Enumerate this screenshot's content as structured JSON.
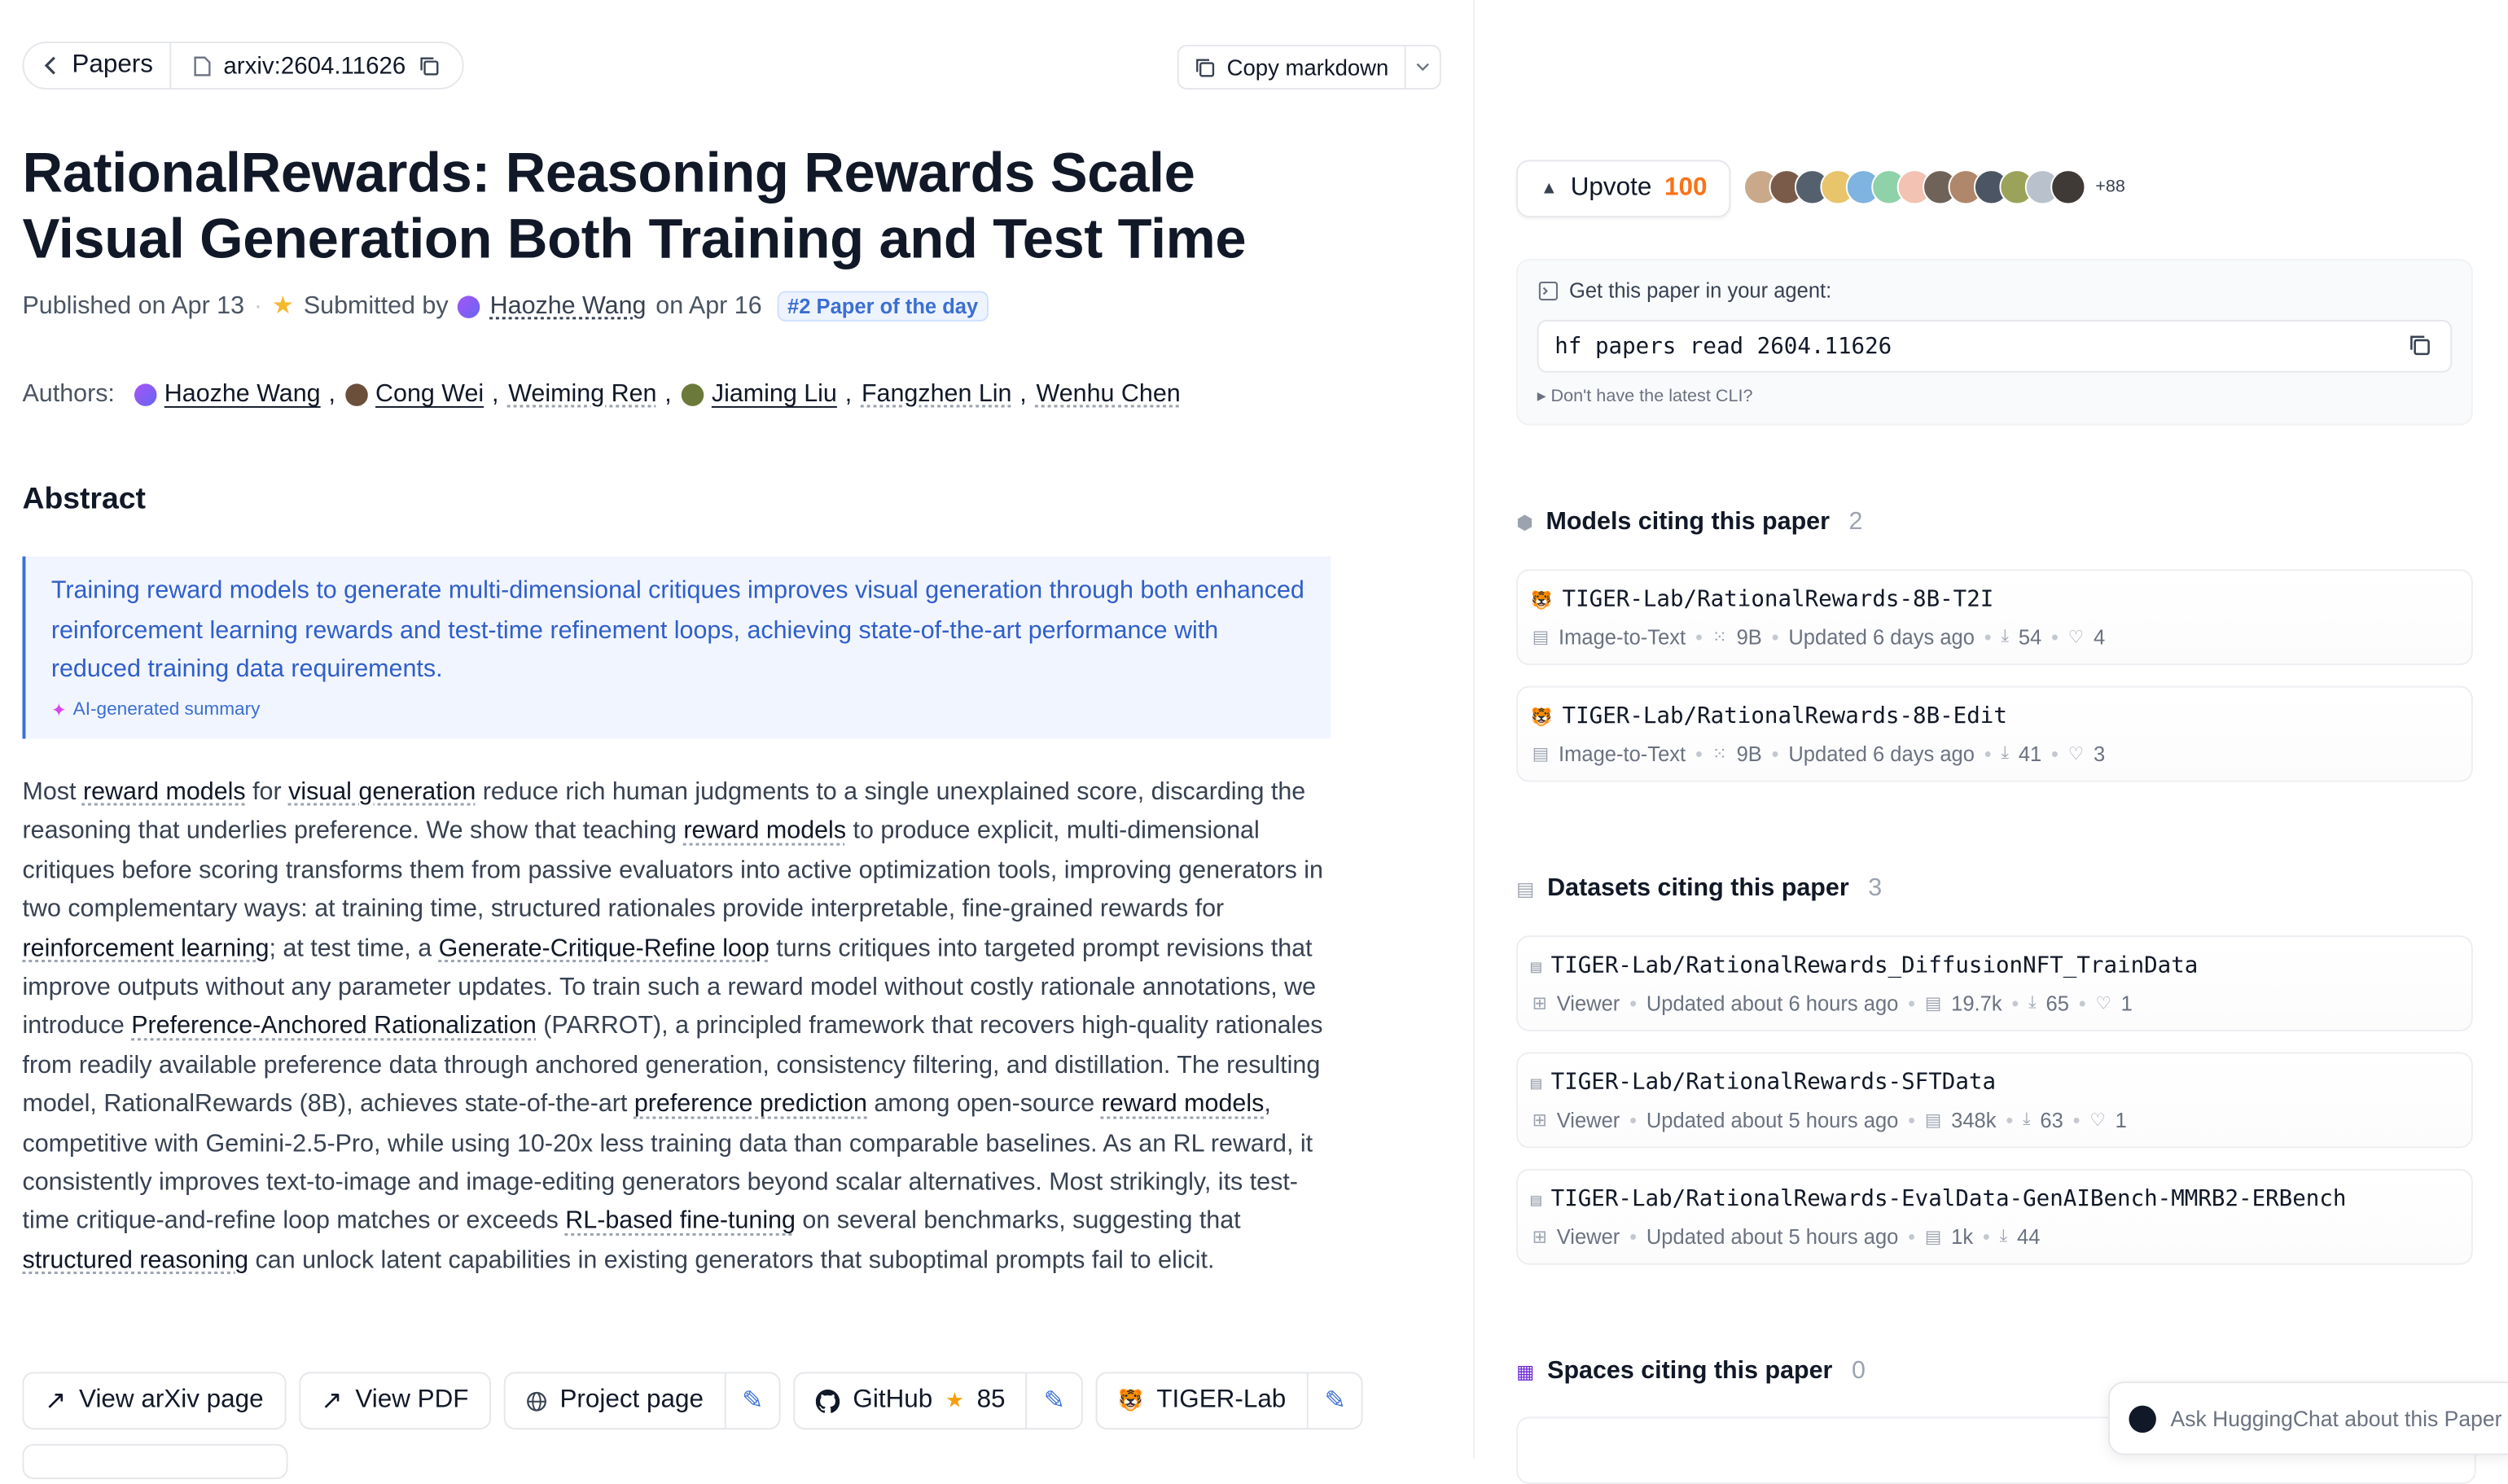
{
  "nav": {
    "back_label": "Papers",
    "paper_id": "arxiv:2604.11626",
    "copy_markdown": "Copy markdown"
  },
  "paper": {
    "title": "RationalRewards: Reasoning Rewards Scale Visual Generation Both Training and Test Time",
    "published": "Published on Apr 13",
    "submitted_by": "Submitted by",
    "submitter": "Haozhe Wang",
    "submitted_on": "on Apr 16",
    "badge": "#2 Paper of the day",
    "authors_label": "Authors:",
    "authors": [
      "Haozhe Wang",
      "Cong Wei",
      "Weiming Ren",
      "Jiaming Liu",
      "Fangzhen Lin",
      "Wenhu Chen"
    ]
  },
  "abstract": {
    "heading": "Abstract",
    "summary": "Training reward models to generate multi-dimensional critiques improves visual generation through both enhanced reinforcement learning rewards and test-time refinement loops, achieving state-of-the-art performance with reduced training data requirements.",
    "ai_label": "AI-generated summary",
    "text": {
      "s1": "Most ",
      "k1": "reward models",
      "s2": " for ",
      "k2": "visual generation",
      "s3": " reduce rich human judgments to a single unexplained score, discarding the reasoning that underlies preference. We show that teaching ",
      "k3": "reward models",
      "s4": " to produce explicit, multi-dimensional critiques before scoring transforms them from passive evaluators into active optimization tools, improving generators in two complementary ways: at training time, structured rationales provide interpretable, fine-grained rewards for ",
      "k4": "reinforcement learning",
      "s5": "; at test time, a ",
      "k5": "Generate-Critique-Refine loop",
      "s6": " turns critiques into targeted prompt revisions that improve outputs without any parameter updates. To train such a reward model without costly rationale annotations, we introduce ",
      "k6": "Preference-Anchored Rationalization",
      "s7": " (PARROT), a principled framework that recovers high-quality rationales from readily available preference data through anchored generation, consistency filtering, and distillation. The resulting model, RationalRewards (8B), achieves state-of-the-art ",
      "k7": "preference prediction",
      "s8": " among open-source ",
      "k8": "reward models",
      "s9": ", competitive with Gemini-2.5-Pro, while using 10-20x less training data than comparable baselines. As an RL reward, it consistently improves text-to-image and image-editing generators beyond scalar alternatives. Most strikingly, its test-time critique-and-refine loop matches or exceeds ",
      "k9": "RL-based fine-tuning",
      "s10": " on several benchmarks, suggesting that ",
      "k10": "structured reasoning",
      "s11": " can unlock latent capabilities in existing generators that suboptimal prompts fail to elicit."
    }
  },
  "links": {
    "arxiv": "View arXiv page",
    "pdf": "View PDF",
    "project": "Project page",
    "github": "GitHub",
    "github_stars": "85",
    "org": "TIGER-Lab"
  },
  "sidebar": {
    "upvote_label": "Upvote",
    "upvote_count": "100",
    "upvoters_more": "+88",
    "agent_heading": "Get this paper in your agent:",
    "agent_command": "hf papers read 2604.11626",
    "cli_hint": "▸ Don't have the latest CLI?",
    "models": {
      "heading": "Models citing this paper",
      "count": "2",
      "items": [
        {
          "name": "TIGER-Lab/RationalRewards-8B-T2I",
          "task": "Image-to-Text",
          "size": "9B",
          "updated": "Updated 6 days ago",
          "downloads": "54",
          "likes": "4"
        },
        {
          "name": "TIGER-Lab/RationalRewards-8B-Edit",
          "task": "Image-to-Text",
          "size": "9B",
          "updated": "Updated 6 days ago",
          "downloads": "41",
          "likes": "3"
        }
      ]
    },
    "datasets": {
      "heading": "Datasets citing this paper",
      "count": "3",
      "items": [
        {
          "name": "TIGER-Lab/RationalRewards_DiffusionNFT_TrainData",
          "viewer": "Viewer",
          "updated": "Updated about 6 hours ago",
          "rows": "19.7k",
          "downloads": "65",
          "likes": "1"
        },
        {
          "name": "TIGER-Lab/RationalRewards-SFTData",
          "viewer": "Viewer",
          "updated": "Updated about 5 hours ago",
          "rows": "348k",
          "downloads": "63",
          "likes": "1"
        },
        {
          "name": "TIGER-Lab/RationalRewards-EvalData-GenAIBench-MMRB2-ERBench",
          "viewer": "Viewer",
          "updated": "Updated about 5 hours ago",
          "rows": "1k",
          "downloads": "44"
        }
      ]
    },
    "spaces": {
      "heading": "Spaces citing this paper",
      "count": "0"
    },
    "ask_chat": "Ask HuggingChat about this Paper"
  },
  "colors": {
    "accent_blue": "#3b6fd4",
    "upvote_orange": "#f97316",
    "summary_bg": "#f1f5ff"
  }
}
